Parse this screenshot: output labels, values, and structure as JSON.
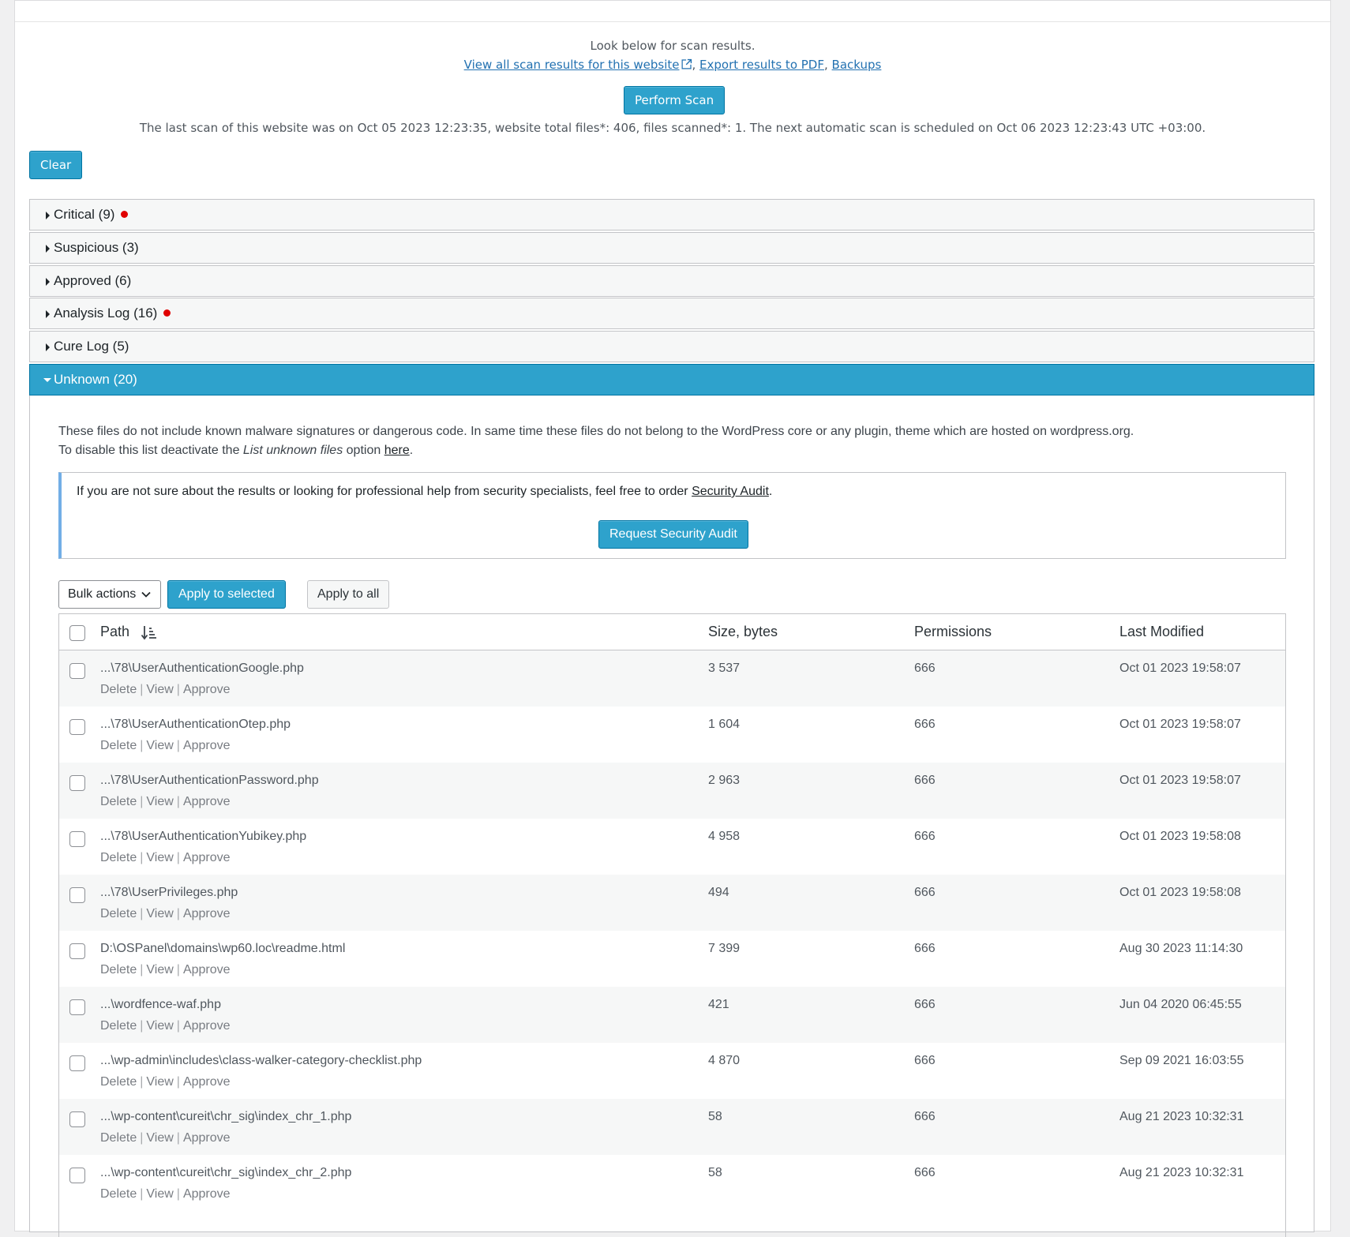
{
  "scan": {
    "intro": "Look below for scan results.",
    "links": [
      "View all scan results for this website",
      "Export results to PDF",
      "Backups"
    ],
    "perform_label": "Perform Scan",
    "last_scan": "The last scan of this website was on Oct 05 2023 12:23:35, website total files*: 406, files scanned*: 1. The next automatic scan is scheduled on Oct 06 2023 12:23:43 UTC +03:00.",
    "clear_label": "Clear"
  },
  "accordion": [
    {
      "label": "Critical (9)",
      "alert": true
    },
    {
      "label": "Suspicious (3)",
      "alert": false
    },
    {
      "label": "Approved (6)",
      "alert": false
    },
    {
      "label": "Analysis Log (16)",
      "alert": true
    },
    {
      "label": "Cure Log (5)",
      "alert": false
    },
    {
      "label": "Unknown (20)",
      "alert": false,
      "open": true
    }
  ],
  "unknown": {
    "desc_line1": "These files do not include known malware signatures or dangerous code. In same time these files do not belong to the WordPress core or any plugin, theme which are hosted on wordpress.org.",
    "desc_line2_pre": "To disable this list deactivate the ",
    "desc_line2_em": "List unknown files",
    "desc_line2_mid": " option ",
    "desc_line2_link": "here",
    "desc_line2_post": "."
  },
  "notice": {
    "text": "If you are not sure about the results or looking for professional help from security specialists, feel free to order ",
    "link": "Security Audit",
    "suffix": ".",
    "button": "Request Security Audit"
  },
  "toolbar": {
    "bulk_label": "Bulk actions",
    "apply_selected": "Apply to selected",
    "apply_all": "Apply to all"
  },
  "table": {
    "columns": [
      "Path",
      "Size, bytes",
      "Permissions",
      "Last Modified"
    ],
    "row_actions": [
      "Delete",
      "View",
      "Approve"
    ],
    "rows": [
      {
        "path": "...\\78\\UserAuthenticationGoogle.php",
        "size": "3 537",
        "perm": "666",
        "modified": "Oct 01 2023 19:58:07"
      },
      {
        "path": "...\\78\\UserAuthenticationOtep.php",
        "size": "1 604",
        "perm": "666",
        "modified": "Oct 01 2023 19:58:07"
      },
      {
        "path": "...\\78\\UserAuthenticationPassword.php",
        "size": "2 963",
        "perm": "666",
        "modified": "Oct 01 2023 19:58:07"
      },
      {
        "path": "...\\78\\UserAuthenticationYubikey.php",
        "size": "4 958",
        "perm": "666",
        "modified": "Oct 01 2023 19:58:08"
      },
      {
        "path": "...\\78\\UserPrivileges.php",
        "size": "494",
        "perm": "666",
        "modified": "Oct 01 2023 19:58:08"
      },
      {
        "path": "D:\\OSPanel\\domains\\wp60.loc\\readme.html",
        "size": "7 399",
        "perm": "666",
        "modified": "Aug 30 2023 11:14:30"
      },
      {
        "path": "...\\wordfence-waf.php",
        "size": "421",
        "perm": "666",
        "modified": "Jun 04 2020 06:45:55"
      },
      {
        "path": "...\\wp-admin\\includes\\class-walker-category-checklist.php",
        "size": "4 870",
        "perm": "666",
        "modified": "Sep 09 2021 16:03:55"
      },
      {
        "path": "...\\wp-content\\cureit\\chr_sig\\index_chr_1.php",
        "size": "58",
        "perm": "666",
        "modified": "Aug 21 2023 10:32:31"
      },
      {
        "path": "...\\wp-content\\cureit\\chr_sig\\index_chr_2.php",
        "size": "58",
        "perm": "666",
        "modified": "Aug 21 2023 10:32:31"
      }
    ]
  }
}
